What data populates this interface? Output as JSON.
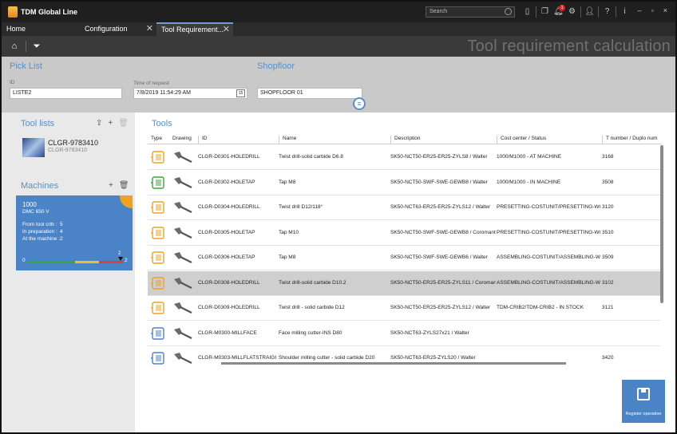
{
  "titlebar": {
    "app_title": "TDM Global Line",
    "search_placeholder": "Search",
    "notification_count": "1",
    "window_controls": {
      "minimize": "–",
      "maximize": "▫",
      "close": "×"
    }
  },
  "tabs": [
    {
      "label": "Home",
      "active": false,
      "closable": false
    },
    {
      "label": "Configuration",
      "active": false,
      "closable": true
    },
    {
      "label": "Tool Requirement...",
      "active": true,
      "closable": true
    }
  ],
  "toolbar": {
    "home_icon": "home-icon",
    "filter_icon": "filter-icon",
    "page_heading": "Tool requirement calculation"
  },
  "header": {
    "pick_list_title": "Pick List",
    "shopfloor_title": "Shopfloor",
    "id_label": "ID",
    "id_value": "LISTE2",
    "time_label": "Time of request",
    "time_value": "7/8/2019 11:54:29 AM",
    "calendar_icon_text": "15",
    "shopfloor_value": "SHOPFLOOR 01"
  },
  "left_panel": {
    "tool_lists_title": "Tool lists",
    "tool_list": {
      "name": "CLGR-9783410",
      "sub": "CLGR-9783410"
    },
    "machines_title": "Machines",
    "machine": {
      "id": "1000",
      "type": "DMC 650 V",
      "rows": [
        {
          "label": "From tool crib :",
          "value": "5"
        },
        {
          "label": "In preparation :",
          "value": "4"
        },
        {
          "label": "At the machine :",
          "value": "2"
        }
      ],
      "gauge_min": "0",
      "gauge_max": "2",
      "gauge_marker": "2",
      "gauge_segments": [
        {
          "color": "#3aa63a",
          "fraction": 0.5
        },
        {
          "color": "#e8c22a",
          "fraction": 0.25
        },
        {
          "color": "#d9403a",
          "fraction": 0.25
        }
      ]
    }
  },
  "tools": {
    "title": "Tools",
    "columns": [
      "Type",
      "Drawing",
      "ID",
      "Name",
      "Description",
      "Cost center / Status",
      "T number / Duplo num"
    ],
    "rows": [
      {
        "id": "CLGR-D0301-HOLEDRILL",
        "name": "Twist drill-solid carbide D6.8",
        "description": "SK50-NCT50-ER25-ER25-ZYLS8 / Walter",
        "status": "1000/M1000 - AT MACHINE",
        "tnum": "3168",
        "icon": "yellow-drill-holder-icon",
        "color": "#f0a21e",
        "selected": false
      },
      {
        "id": "CLGR-D0302-HOLETAP",
        "name": "Tap M8",
        "description": "SK50-NCT50-SWF-SWE-GEWB8 / Walter",
        "status": "1000/M1000 - IN MACHINE",
        "tnum": "3508",
        "icon": "green-tap-holder-icon",
        "color": "#3aa63a",
        "selected": false
      },
      {
        "id": "CLGR-D0304-HOLEDRILL",
        "name": "Twist drill D12/118°",
        "description": "SK50-NCT63-ER25-ER25-ZYLS12 / Walter",
        "status": "PRESETTING-COSTUNIT/PRESETTING-WORKI",
        "tnum": "3120",
        "icon": "orange-drill-holder-icon",
        "color": "#f0a21e",
        "selected": false
      },
      {
        "id": "CLGR-D0305-HOLETAP",
        "name": "Tap M10",
        "description": "SK50-NCT50-SWF-SWE-GEWB8 / Coromant",
        "status": "PRESETTING-COSTUNIT/PRESETTING-WORKI",
        "tnum": "3510",
        "icon": "orange-tap-holder-icon",
        "color": "#f0a21e",
        "selected": false
      },
      {
        "id": "CLGR-D0306-HOLETAP",
        "name": "Tap M8",
        "description": "SK50-NCT50-SWF-SWE-GEWB6 / Walter",
        "status": "ASSEMBLING-COSTUNIT/ASSEMBLING-WOR",
        "tnum": "3509",
        "icon": "wrench-assembly-icon",
        "color": "#f0a21e",
        "selected": false
      },
      {
        "id": "CLGR-D0308-HOLEDRILL",
        "name": "Twist drill-solid carbide D10.2",
        "description": "SK50-NCT50-ER25-ER25-ZYLS11 / Coromant",
        "status": "ASSEMBLING-COSTUNIT/ASSEMBLING-WOR",
        "tnum": "3102",
        "icon": "wrench-assembly-icon",
        "color": "#f0a21e",
        "selected": true
      },
      {
        "id": "CLGR-D0309-HOLEDRILL",
        "name": "Twist drill - solid carbide D12",
        "description": "SK50-NCT50-ER25-ER25-ZYLS12 / Walter",
        "status": "TDM-CRIB2/TDM-CRIB2 - IN STOCK",
        "tnum": "3121",
        "icon": "orange-crib-icon",
        "color": "#f0a21e",
        "selected": false
      },
      {
        "id": "CLGR-M0300-MILLFACE",
        "name": "Face milling cutter-INS D80",
        "description": "SK50-NCT63-ZYLS27x21 / Walter",
        "status": "",
        "tnum": "",
        "icon": "blue-mill-holder-icon",
        "color": "#4a84c7",
        "selected": false
      },
      {
        "id": "CLGR-M0303-MILLFLATSTRAIGHT",
        "name": "Shoulder milling cutter - solid carbide D20",
        "description": "SK50-NCT63-ER25-ZYLS20 / Walter",
        "status": "",
        "tnum": "3420",
        "icon": "blue-mill-holder-icon",
        "color": "#4a84c7",
        "selected": false
      }
    ]
  },
  "register_button": {
    "label": "Register operation",
    "icon": "save-disk-icon"
  }
}
